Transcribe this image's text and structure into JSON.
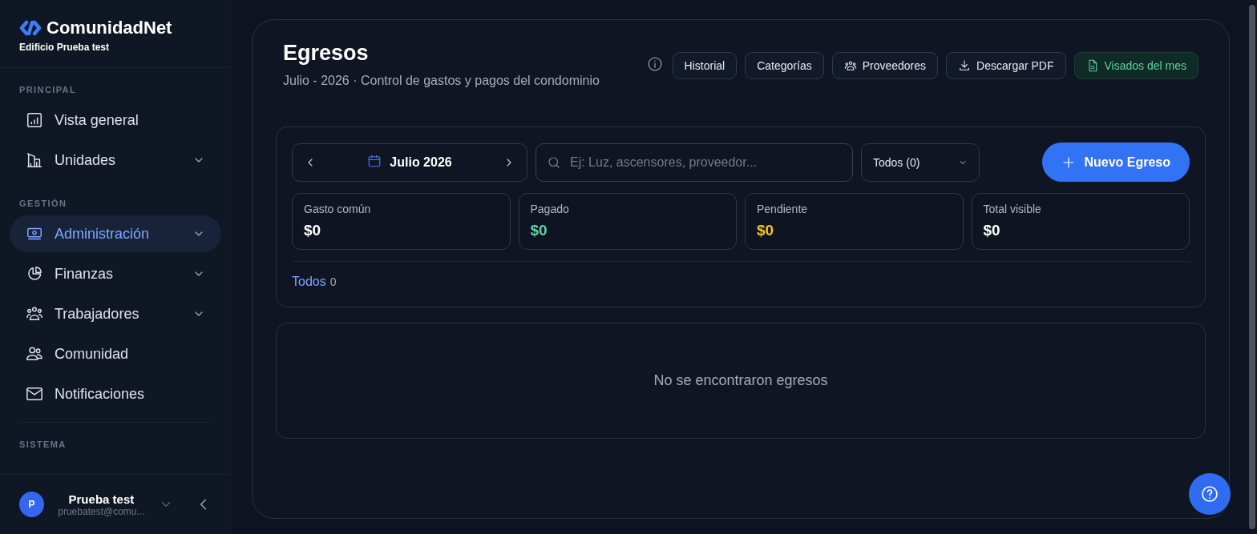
{
  "brand": {
    "name": "ComunidadNet",
    "subtitle": "Edificio Prueba test"
  },
  "sidebar": {
    "sections": [
      {
        "title": "PRINCIPAL",
        "items": [
          {
            "label": "Vista general",
            "kind": "chart",
            "expandable": false,
            "selected": false
          },
          {
            "label": "Unidades",
            "kind": "building",
            "expandable": true,
            "selected": false
          }
        ]
      },
      {
        "title": "GESTIÓN",
        "items": [
          {
            "label": "Administración",
            "kind": "money",
            "expandable": true,
            "selected": true
          },
          {
            "label": "Finanzas",
            "kind": "pie",
            "expandable": true,
            "selected": false
          },
          {
            "label": "Trabajadores",
            "kind": "group",
            "expandable": true,
            "selected": false
          },
          {
            "label": "Comunidad",
            "kind": "people",
            "expandable": false,
            "selected": false
          },
          {
            "label": "Notificaciones",
            "kind": "mail",
            "expandable": false,
            "selected": false
          }
        ]
      },
      {
        "title": "SISTEMA"
      }
    ]
  },
  "user": {
    "initial": "P",
    "name": "Prueba test",
    "email": "pruebatest@comu..."
  },
  "page": {
    "title": "Egresos",
    "subtitle": "Julio - 2026 · Control de gastos y pagos del condominio"
  },
  "header_buttons": [
    {
      "label": "Historial",
      "kind": "plain"
    },
    {
      "label": "Categorías",
      "kind": "plain"
    },
    {
      "label": "Proveedores",
      "kind": "people"
    },
    {
      "label": "Descargar PDF",
      "kind": "download"
    },
    {
      "label": "Visados del mes",
      "kind": "document"
    }
  ],
  "toolbar": {
    "month": "Julio 2026",
    "search": {
      "placeholder": "Ej: Luz, ascensores, proveedor..."
    },
    "filter": "Todos (0)",
    "new_button": "Nuevo Egreso"
  },
  "stats": [
    {
      "label": "Gasto común",
      "value": "$0",
      "color": "#ffffff"
    },
    {
      "label": "Pagado",
      "value": "$0",
      "color": "#5fd3a5"
    },
    {
      "label": "Pendiente",
      "value": "$0",
      "color": "#f5c518"
    },
    {
      "label": "Total visible",
      "value": "$0",
      "color": "#ffffff"
    }
  ],
  "tabs": [
    {
      "label": "Todos",
      "count": "0",
      "selected": true
    }
  ],
  "empty_message": "No se encontraron egresos"
}
